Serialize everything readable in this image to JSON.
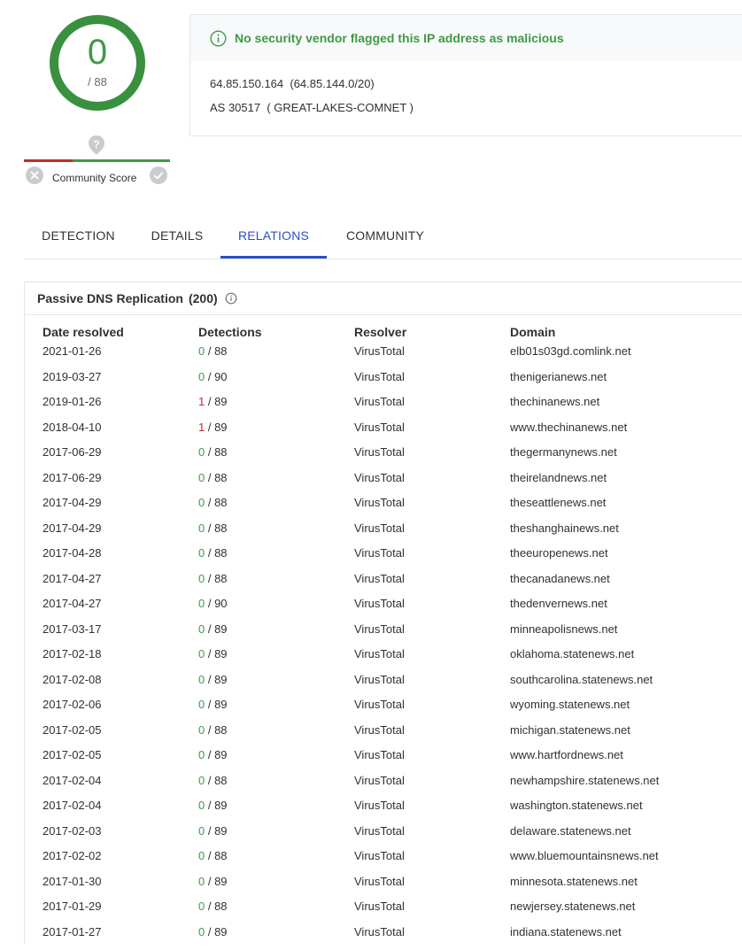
{
  "score": {
    "value": "0",
    "total": "/ 88"
  },
  "community": {
    "label": "Community Score"
  },
  "summary": {
    "status": "No security vendor flagged this IP address as malicious",
    "ip_line": "64.85.150.164  (64.85.144.0/20)",
    "as_line": "AS 30517  ( GREAT-LAKES-COMNET )"
  },
  "tabs": [
    {
      "label": "DETECTION"
    },
    {
      "label": "DETAILS"
    },
    {
      "label": "RELATIONS"
    },
    {
      "label": "COMMUNITY"
    }
  ],
  "active_tab": "RELATIONS",
  "colors": {
    "good": "#3f9a45",
    "bad": "#c62828",
    "accent": "#2b4fc7"
  },
  "passive_dns": {
    "title": "Passive DNS Replication",
    "count": "(200)",
    "columns": [
      "Date resolved",
      "Detections",
      "Resolver",
      "Domain"
    ],
    "rows": [
      {
        "date": "2021-01-26",
        "det": "0",
        "total": " / 88",
        "resolver": "VirusTotal",
        "domain": "elb01s03gd.comlink.net"
      },
      {
        "date": "2019-03-27",
        "det": "0",
        "total": " / 90",
        "resolver": "VirusTotal",
        "domain": "thenigerianews.net"
      },
      {
        "date": "2019-01-26",
        "det": "1",
        "total": " / 89",
        "resolver": "VirusTotal",
        "domain": "thechinanews.net"
      },
      {
        "date": "2018-04-10",
        "det": "1",
        "total": " / 89",
        "resolver": "VirusTotal",
        "domain": "www.thechinanews.net"
      },
      {
        "date": "2017-06-29",
        "det": "0",
        "total": " / 88",
        "resolver": "VirusTotal",
        "domain": "thegermanynews.net"
      },
      {
        "date": "2017-06-29",
        "det": "0",
        "total": " / 88",
        "resolver": "VirusTotal",
        "domain": "theirelandnews.net"
      },
      {
        "date": "2017-04-29",
        "det": "0",
        "total": " / 88",
        "resolver": "VirusTotal",
        "domain": "theseattlenews.net"
      },
      {
        "date": "2017-04-29",
        "det": "0",
        "total": " / 88",
        "resolver": "VirusTotal",
        "domain": "theshanghainews.net"
      },
      {
        "date": "2017-04-28",
        "det": "0",
        "total": " / 88",
        "resolver": "VirusTotal",
        "domain": "theeuropenews.net"
      },
      {
        "date": "2017-04-27",
        "det": "0",
        "total": " / 88",
        "resolver": "VirusTotal",
        "domain": "thecanadanews.net"
      },
      {
        "date": "2017-04-27",
        "det": "0",
        "total": " / 90",
        "resolver": "VirusTotal",
        "domain": "thedenvernews.net"
      },
      {
        "date": "2017-03-17",
        "det": "0",
        "total": " / 89",
        "resolver": "VirusTotal",
        "domain": "minneapolisnews.net"
      },
      {
        "date": "2017-02-18",
        "det": "0",
        "total": " / 89",
        "resolver": "VirusTotal",
        "domain": "oklahoma.statenews.net"
      },
      {
        "date": "2017-02-08",
        "det": "0",
        "total": " / 89",
        "resolver": "VirusTotal",
        "domain": "southcarolina.statenews.net"
      },
      {
        "date": "2017-02-06",
        "det": "0",
        "total": " / 89",
        "resolver": "VirusTotal",
        "domain": "wyoming.statenews.net"
      },
      {
        "date": "2017-02-05",
        "det": "0",
        "total": " / 88",
        "resolver": "VirusTotal",
        "domain": "michigan.statenews.net"
      },
      {
        "date": "2017-02-05",
        "det": "0",
        "total": " / 89",
        "resolver": "VirusTotal",
        "domain": "www.hartfordnews.net"
      },
      {
        "date": "2017-02-04",
        "det": "0",
        "total": " / 88",
        "resolver": "VirusTotal",
        "domain": "newhampshire.statenews.net"
      },
      {
        "date": "2017-02-04",
        "det": "0",
        "total": " / 89",
        "resolver": "VirusTotal",
        "domain": "washington.statenews.net"
      },
      {
        "date": "2017-02-03",
        "det": "0",
        "total": " / 89",
        "resolver": "VirusTotal",
        "domain": "delaware.statenews.net"
      },
      {
        "date": "2017-02-02",
        "det": "0",
        "total": " / 88",
        "resolver": "VirusTotal",
        "domain": "www.bluemountainsnews.net"
      },
      {
        "date": "2017-01-30",
        "det": "0",
        "total": " / 89",
        "resolver": "VirusTotal",
        "domain": "minnesota.statenews.net"
      },
      {
        "date": "2017-01-29",
        "det": "0",
        "total": " / 88",
        "resolver": "VirusTotal",
        "domain": "newjersey.statenews.net"
      },
      {
        "date": "2017-01-27",
        "det": "0",
        "total": " / 89",
        "resolver": "VirusTotal",
        "domain": "indiana.statenews.net"
      }
    ]
  }
}
